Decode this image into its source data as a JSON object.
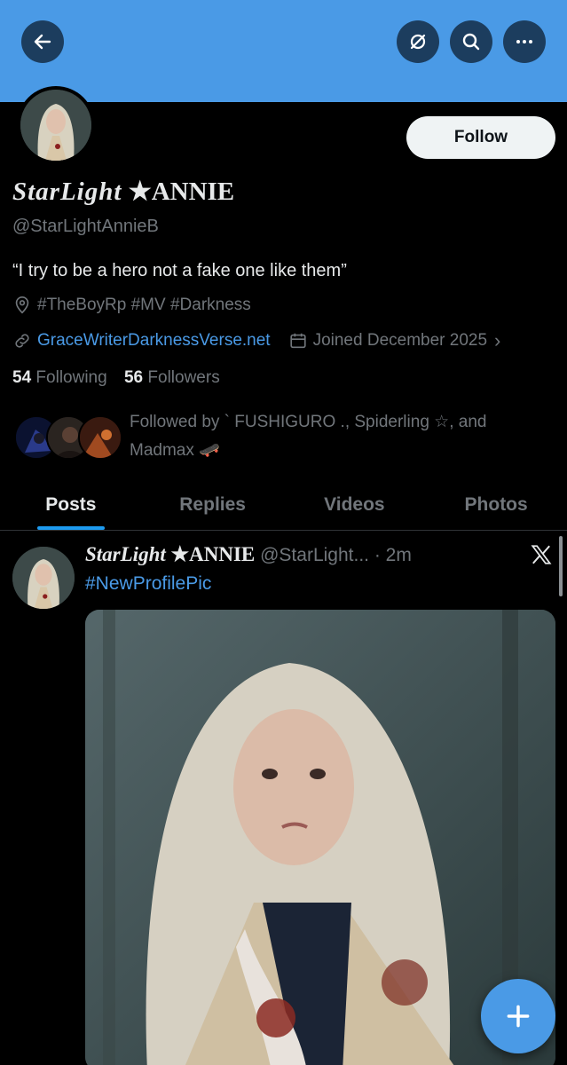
{
  "header": {
    "back_icon": "arrow-left-icon",
    "grok_icon": "grok-icon",
    "search_icon": "search-icon",
    "more_icon": "more-horizontal-icon",
    "banner_color": "#4a9ae6"
  },
  "profile": {
    "follow_label": "Follow",
    "display_name_script": "StarLight",
    "display_name_star": "★",
    "display_name_rest": "ANNIE",
    "handle": "@StarLightAnnieB",
    "bio": "“I try to be a hero not a fake one like them”",
    "location": "#TheBoyRp #MV #Darkness",
    "website": "GraceWriterDarknessVerse.net",
    "joined": "Joined December 2025",
    "following_count": "54",
    "following_label": "Following",
    "followers_count": "56",
    "followers_label": "Followers",
    "followed_by": "Followed by ` FUSHIGURO ., Spiderling ☆, and Madmax 🛹"
  },
  "tabs": [
    {
      "label": "Posts"
    },
    {
      "label": "Replies"
    },
    {
      "label": "Videos"
    },
    {
      "label": "Photos"
    }
  ],
  "post": {
    "name_script": "StarLight",
    "name_star": "★",
    "name_rest": "ANNIE",
    "handle": "@StarLight...",
    "time": "· 2m",
    "hashtag": "#NewProfilePic",
    "source_icon": "x-logo-icon"
  },
  "fab": {
    "icon": "plus-icon",
    "color": "#4a9ae6"
  }
}
